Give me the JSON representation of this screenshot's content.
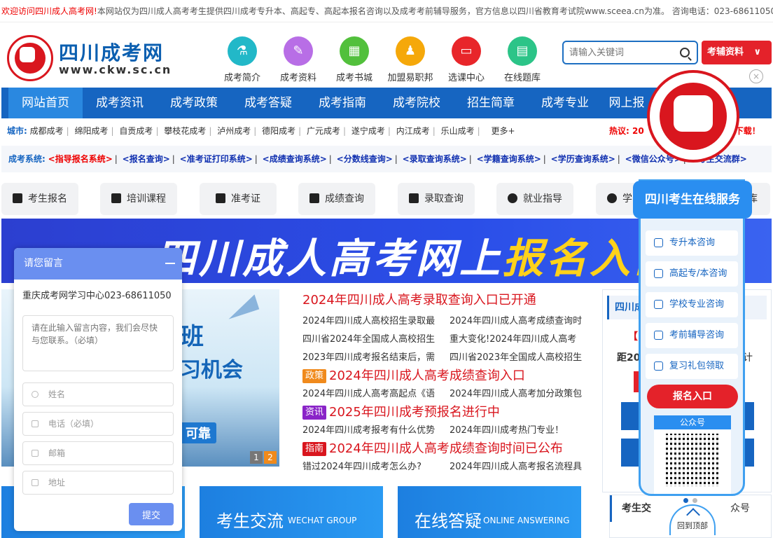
{
  "topbar": {
    "welcome": "欢迎访问四川成人高考网!",
    "notice": "本网站仅为四川成人高考考生提供四川成考专升本、高起专、高起本报名咨询以及成考考前辅导服务，官方信息以四川省教育考试院www.sceea.cn为准。 咨询电话：023-68611050"
  },
  "logo": {
    "title": "四川成考网",
    "url": "www.ckw.sc.cn"
  },
  "nav_icons": [
    {
      "label": "成考简介",
      "color": "#22b8c8"
    },
    {
      "label": "成考资料",
      "color": "#b86ee6"
    },
    {
      "label": "成考书城",
      "color": "#52c03c"
    },
    {
      "label": "加盟易职邦",
      "color": "#f5a80a"
    },
    {
      "label": "选课中心",
      "color": "#e8262a"
    },
    {
      "label": "在线题库",
      "color": "#2cc488"
    }
  ],
  "search": {
    "placeholder": "请输入关键词"
  },
  "fudao_button": "考辅资料",
  "main_nav": [
    "网站首页",
    "成考资讯",
    "成考政策",
    "成考答疑",
    "成考指南",
    "成考院校",
    "招生简章",
    "成考专业",
    "网上报"
  ],
  "city": {
    "label": "城市:",
    "items": [
      "成都成考",
      "绵阳成考",
      "自贡成考",
      "攀枝花成考",
      "泸州成考",
      "德阳成考",
      "广元成考",
      "遂宁成考",
      "内江成考",
      "乐山成考"
    ],
    "more": "更多+"
  },
  "hot": {
    "label": "热议:",
    "text": "20",
    "tail": "下载！"
  },
  "systems": {
    "label": "成考系统:",
    "items": [
      "<指导报名系统>",
      "<报名查询>",
      "<准考证打印系统>",
      "<成绩查询系统>",
      "<分数线查询>",
      "<录取查询系统>",
      "<学籍查询系统>",
      "<学历查询系统>",
      "<微信公众号>",
      "<考生交流群>"
    ]
  },
  "quick_buttons": [
    "考生报名",
    "培训课程",
    "准考证",
    "成绩查询",
    "录取查询",
    "就业指导",
    "学"
  ],
  "quick_tail": "库",
  "banner": {
    "white": "四川成人高考网上",
    "yellow": "报名入口"
  },
  "slide": {
    "line1": "班",
    "line2": "习机会",
    "line3": "可靠",
    "pages": [
      "1",
      "2"
    ]
  },
  "news": {
    "headline": "2024年四川成人高考录取查询入口已开通",
    "items1": [
      "2024年四川成人高校招生录取最",
      "2024年四川成人高考成绩查询时",
      "四川省2024年全国成人高校招生",
      "重大变化!2024年四川成人高考",
      "2023年四川成考报名结束后，需",
      "四川省2023年全国成人高校招生"
    ],
    "tag1": "政策",
    "head2": "2024年四川成人高考成绩查询入口",
    "items2": [
      "2024年四川成人高考高起点《语",
      "2024年四川成人高考加分政策包"
    ],
    "tag2": "资讯",
    "head3": "2025年四川成考预报名进行中",
    "items3": [
      "2024年四川成考报考有什么优势",
      "2024年四川成考热门专业！"
    ],
    "tag3": "指南",
    "head4": "2024年四川成人高考成绩查询时间已公布",
    "items4": [
      "错过2024年四川成考怎么办?",
      "2024年四川成人高考报名流程具"
    ]
  },
  "right_panel": {
    "head": "四川成",
    "red": "【2",
    "dist": "距202",
    "suffix": "计"
  },
  "right_panel2": {
    "head": "考生交",
    "tail": "众号"
  },
  "bottom_banners": [
    {
      "big": "考生交流",
      "small": "WECHAT GROUP"
    },
    {
      "big": "在线答疑",
      "small": "ONLINE ANSWERING"
    }
  ],
  "message": {
    "title": "请您留言",
    "phone": "重庆成考网学习中心023-68611050",
    "content_placeholder": "请在此输入留言内容，我们会尽快与您联系。（必填）",
    "name": "姓名",
    "tel": "电话（必填）",
    "email": "邮箱",
    "address": "地址",
    "submit": "提交"
  },
  "service": {
    "title": "四川考生在线服务",
    "options": [
      "专升本咨询",
      "高起专/本咨询",
      "学校专业咨询",
      "考前辅导咨询",
      "复习礼包领取"
    ],
    "signup": "报名入口",
    "wechat": "公众号",
    "totop": "回到顶部",
    "close": "×"
  }
}
